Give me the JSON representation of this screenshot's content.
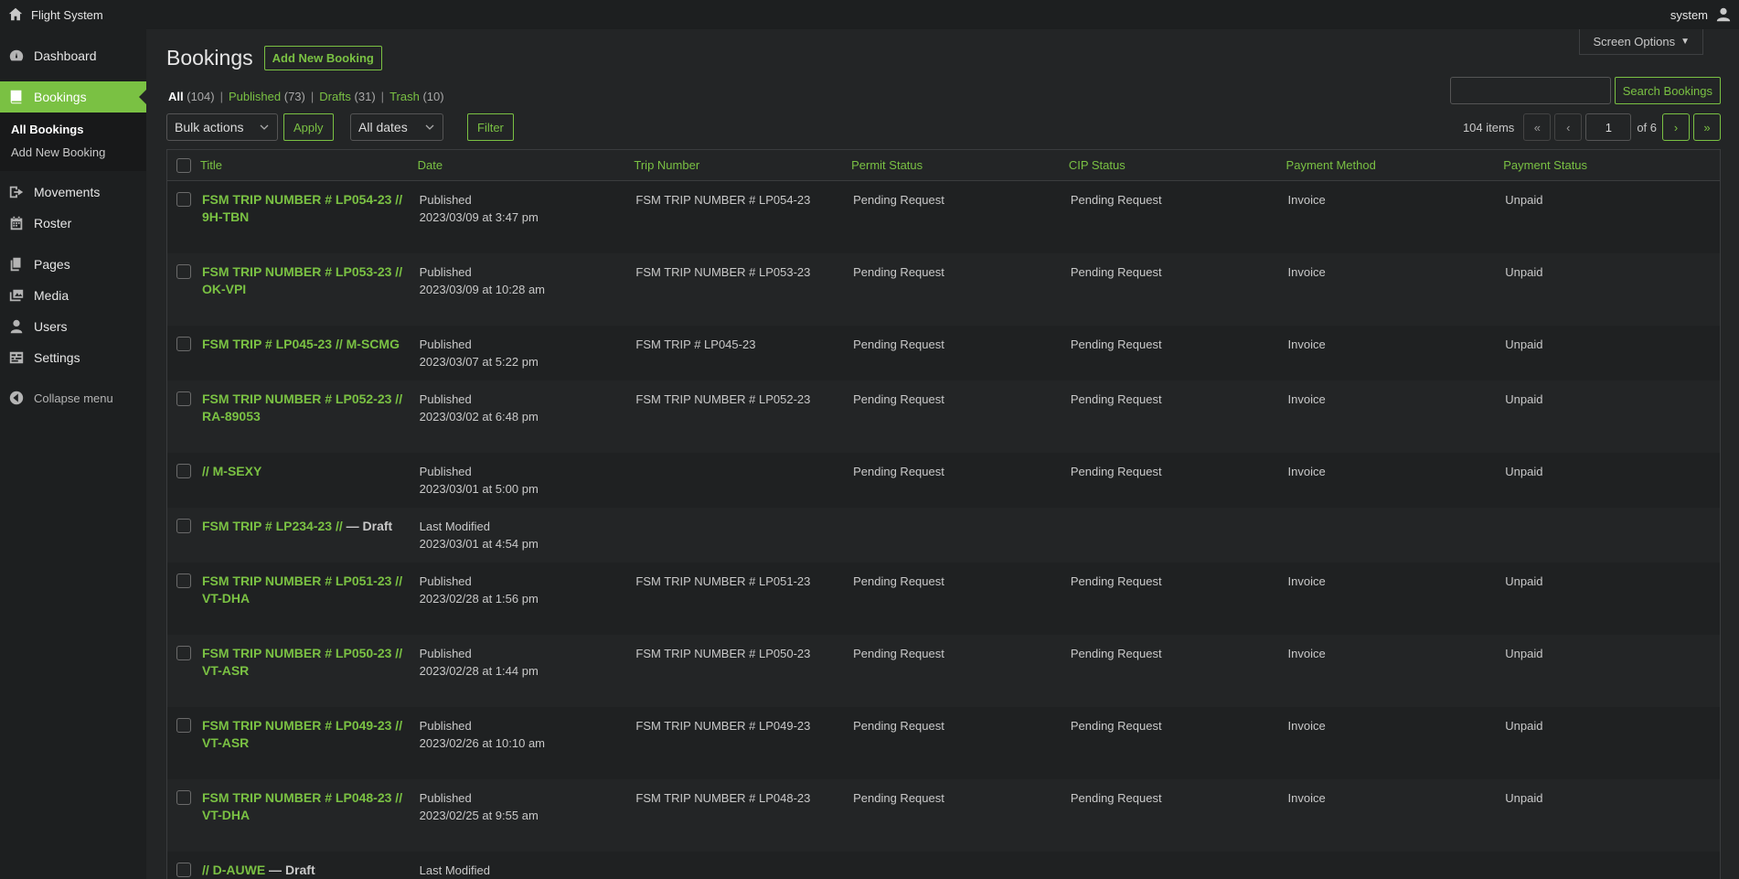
{
  "topbar": {
    "site_name": "Flight System",
    "user": "system"
  },
  "sidebar": {
    "items": [
      {
        "label": "Dashboard",
        "icon": "dashboard-icon"
      },
      {
        "label": "Bookings",
        "icon": "book-icon"
      },
      {
        "label": "Movements",
        "icon": "exit-icon"
      },
      {
        "label": "Roster",
        "icon": "calendar-icon"
      },
      {
        "label": "Pages",
        "icon": "pages-icon"
      },
      {
        "label": "Media",
        "icon": "media-icon"
      },
      {
        "label": "Users",
        "icon": "user-icon"
      },
      {
        "label": "Settings",
        "icon": "settings-icon"
      }
    ],
    "submenu": [
      "All Bookings",
      "Add New Booking"
    ],
    "collapse": "Collapse menu"
  },
  "screen_options": "Screen Options",
  "page": {
    "title": "Bookings",
    "add_new": "Add New Booking"
  },
  "filters": {
    "all": "All",
    "all_count": "(104)",
    "published": "Published",
    "published_count": "(73)",
    "drafts": "Drafts",
    "drafts_count": "(31)",
    "trash": "Trash",
    "trash_count": "(10)",
    "separator": "|"
  },
  "search": {
    "value": "",
    "button": "Search Bookings"
  },
  "tablenav": {
    "bulk_actions": "Bulk actions",
    "apply": "Apply",
    "all_dates": "All dates",
    "filter": "Filter",
    "items": "104 items",
    "first": "«",
    "prev": "‹",
    "current_page": "1",
    "of": "of 6",
    "next": "›",
    "last": "»"
  },
  "columns": [
    "Title",
    "Date",
    "Trip Number",
    "Permit Status",
    "CIP Status",
    "Payment Method",
    "Payment Status"
  ],
  "rows": [
    {
      "title1": "FSM TRIP NUMBER # LP054-23 //",
      "title2": "9H-TBN",
      "draft": "",
      "status": "Published",
      "date": "2023/03/09 at 3:47 pm",
      "trip": "FSM TRIP NUMBER # LP054-23",
      "permit": "Pending Request",
      "cip": "Pending Request",
      "method": "Invoice",
      "payment": "Unpaid"
    },
    {
      "title1": "FSM TRIP NUMBER # LP053-23 //",
      "title2": "OK-VPI",
      "draft": "",
      "status": "Published",
      "date": "2023/03/09 at 10:28 am",
      "trip": "FSM TRIP NUMBER # LP053-23",
      "permit": "Pending Request",
      "cip": "Pending Request",
      "method": "Invoice",
      "payment": "Unpaid"
    },
    {
      "title1": "FSM TRIP # LP045-23 // M-SCMG",
      "title2": "",
      "draft": "",
      "status": "Published",
      "date": "2023/03/07 at 5:22 pm",
      "trip": "FSM TRIP # LP045-23",
      "permit": "Pending Request",
      "cip": "Pending Request",
      "method": "Invoice",
      "payment": "Unpaid"
    },
    {
      "title1": "FSM TRIP NUMBER # LP052-23 //",
      "title2": "RA-89053",
      "draft": "",
      "status": "Published",
      "date": "2023/03/02 at 6:48 pm",
      "trip": "FSM TRIP NUMBER # LP052-23",
      "permit": "Pending Request",
      "cip": "Pending Request",
      "method": "Invoice",
      "payment": "Unpaid"
    },
    {
      "title1": "// M-SEXY",
      "title2": "",
      "draft": "",
      "status": "Published",
      "date": "2023/03/01 at 5:00 pm",
      "trip": "",
      "permit": "Pending Request",
      "cip": "Pending Request",
      "method": "Invoice",
      "payment": "Unpaid"
    },
    {
      "title1": "FSM TRIP # LP234-23 //",
      "title2": "",
      "draft": " — Draft",
      "status": "Last Modified",
      "date": "2023/03/01 at 4:54 pm",
      "trip": "",
      "permit": "",
      "cip": "",
      "method": "",
      "payment": ""
    },
    {
      "title1": "FSM TRIP NUMBER # LP051-23 //",
      "title2": "VT-DHA",
      "draft": "",
      "status": "Published",
      "date": "2023/02/28 at 1:56 pm",
      "trip": "FSM TRIP NUMBER # LP051-23",
      "permit": "Pending Request",
      "cip": "Pending Request",
      "method": "Invoice",
      "payment": "Unpaid"
    },
    {
      "title1": "FSM TRIP NUMBER # LP050-23 //",
      "title2": "VT-ASR",
      "draft": "",
      "status": "Published",
      "date": "2023/02/28 at 1:44 pm",
      "trip": "FSM TRIP NUMBER # LP050-23",
      "permit": "Pending Request",
      "cip": "Pending Request",
      "method": "Invoice",
      "payment": "Unpaid"
    },
    {
      "title1": "FSM TRIP NUMBER # LP049-23 //",
      "title2": "VT-ASR",
      "draft": "",
      "status": "Published",
      "date": "2023/02/26 at 10:10 am",
      "trip": "FSM TRIP NUMBER # LP049-23",
      "permit": "Pending Request",
      "cip": "Pending Request",
      "method": "Invoice",
      "payment": "Unpaid"
    },
    {
      "title1": "FSM TRIP NUMBER # LP048-23 //",
      "title2": "VT-DHA",
      "draft": "",
      "status": "Published",
      "date": "2023/02/25 at 9:55 am",
      "trip": "FSM TRIP NUMBER # LP048-23",
      "permit": "Pending Request",
      "cip": "Pending Request",
      "method": "Invoice",
      "payment": "Unpaid"
    },
    {
      "title1": "// D-AUWE",
      "title2": "",
      "draft": " — Draft",
      "status": "Last Modified",
      "date": "",
      "trip": "",
      "permit": "",
      "cip": "",
      "method": "",
      "payment": ""
    }
  ]
}
